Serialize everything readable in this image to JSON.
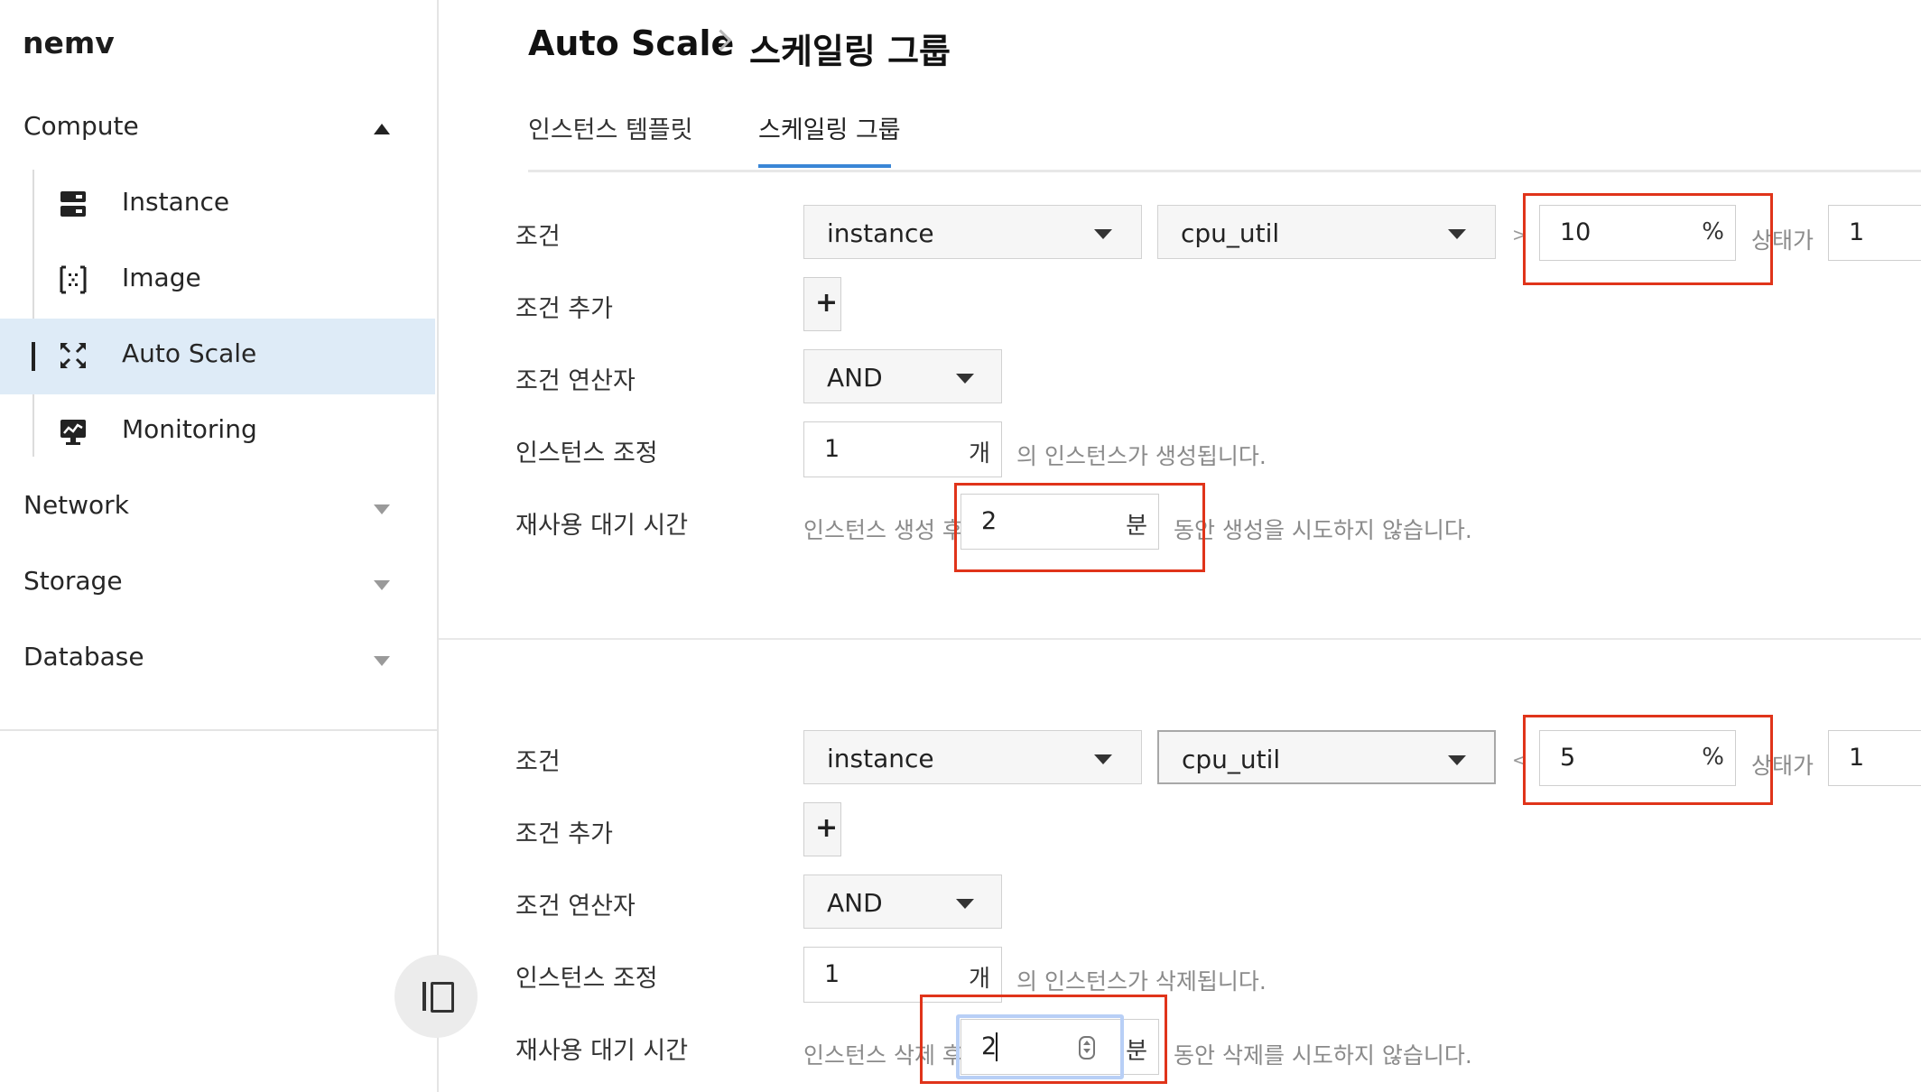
{
  "app": {
    "brand": "nemv"
  },
  "sidebar": {
    "compute": {
      "label": "Compute"
    },
    "items": [
      {
        "label": "Instance",
        "icon": "server-icon"
      },
      {
        "label": "Image",
        "icon": "image-icon"
      },
      {
        "label": "Auto Scale",
        "icon": "expand-arrows-icon",
        "active": true
      },
      {
        "label": "Monitoring",
        "icon": "monitor-chart-icon"
      }
    ],
    "network": {
      "label": "Network"
    },
    "storage": {
      "label": "Storage"
    },
    "database": {
      "label": "Database"
    }
  },
  "breadcrumb": {
    "parent": "Auto Scale",
    "current": "스케일링 그룹"
  },
  "tabs": [
    {
      "label": "인스턴스 템플릿"
    },
    {
      "label": "스케일링 그룹",
      "active": true
    }
  ],
  "labels": {
    "condition": "조건",
    "add_condition": "조건 추가",
    "condition_operator": "조건 연산자",
    "instance_adjust": "인스턴스 조정",
    "cooldown": "재사용 대기 시간",
    "state_is": "상태가",
    "count_unit": "개",
    "minute_unit": "분",
    "percent": "%",
    "plus": "+"
  },
  "scale_out": {
    "resource": "instance",
    "metric": "cpu_util",
    "comparator": ">",
    "threshold": "10",
    "duration": "1",
    "operator": "AND",
    "adjust_count": "1",
    "adjust_text": "의 인스턴스가 생성됩니다.",
    "cooldown_prefix": "인스턴스 생성 후",
    "cooldown_value": "2",
    "cooldown_suffix": "동안 생성을 시도하지 않습니다."
  },
  "scale_in": {
    "resource": "instance",
    "metric": "cpu_util",
    "comparator": "<",
    "threshold": "5",
    "duration": "1",
    "operator": "AND",
    "adjust_count": "1",
    "adjust_text": "의 인스턴스가 삭제됩니다.",
    "cooldown_prefix": "인스턴스 삭제 후",
    "cooldown_value": "2",
    "cooldown_suffix": "동안 삭제를 시도하지 않습니다."
  },
  "colors": {
    "active_bg": "#deebf7",
    "tab_accent": "#3a86d6",
    "highlight_box": "#e0341a",
    "focus": "#b8cff6"
  }
}
